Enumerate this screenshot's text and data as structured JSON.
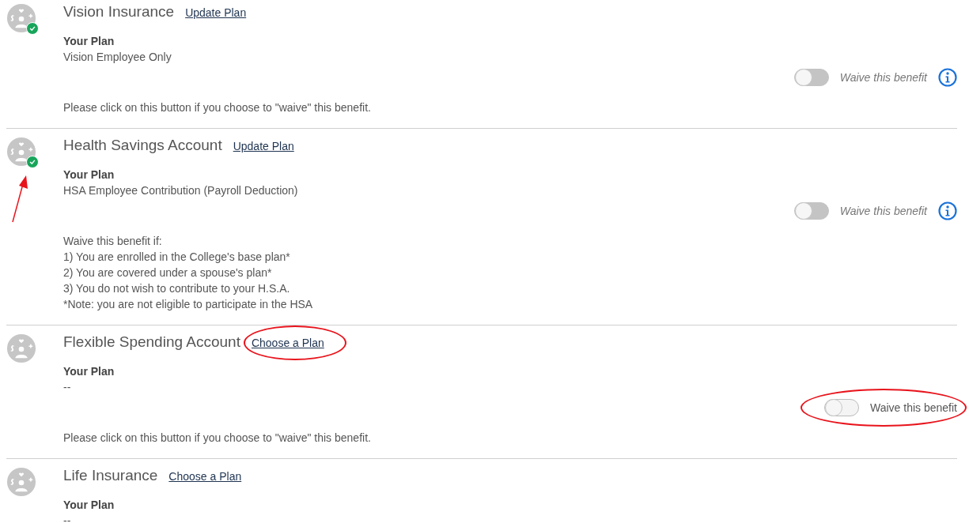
{
  "benefits": [
    {
      "title": "Vision Insurance",
      "link": "Update Plan",
      "enrolled": true,
      "plan_label": "Your Plan",
      "plan": "Vision Employee Only",
      "waive": {
        "label": "Waive this benefit",
        "on": false,
        "disabled": true,
        "info": true
      },
      "description": [
        "Please click on this button if you choose to \"waive\" this benefit."
      ],
      "annotated_badge": false,
      "annotated_link": false,
      "annotated_waive": false
    },
    {
      "title": "Health Savings Account",
      "link": "Update Plan",
      "enrolled": true,
      "plan_label": "Your Plan",
      "plan": "HSA Employee Contribution (Payroll Deduction)",
      "waive": {
        "label": "Waive this benefit",
        "on": false,
        "disabled": true,
        "info": true
      },
      "description": [
        "Waive this benefit if:",
        "1) You are enrolled in the College's base plan*",
        "2) You are covered under a spouse's plan*",
        "3) You do not wish to contribute to your H.S.A.",
        "*Note: you are not eligible to participate in the HSA"
      ],
      "annotated_badge": true,
      "annotated_link": false,
      "annotated_waive": false
    },
    {
      "title": "Flexible Spending Account",
      "link": "Choose a Plan",
      "enrolled": false,
      "plan_label": "Your Plan",
      "plan": "--",
      "waive": {
        "label": "Waive this benefit",
        "on": false,
        "disabled": false,
        "info": false
      },
      "description": [
        "Please click on this button if you choose to \"waive\" this benefit."
      ],
      "annotated_badge": false,
      "annotated_link": true,
      "annotated_waive": true
    },
    {
      "title": "Life Insurance",
      "link": "Choose a Plan",
      "enrolled": false,
      "plan_label": "Your Plan",
      "plan": "--",
      "annotated_badge": false,
      "annotated_link": false,
      "annotated_waive": false
    }
  ]
}
